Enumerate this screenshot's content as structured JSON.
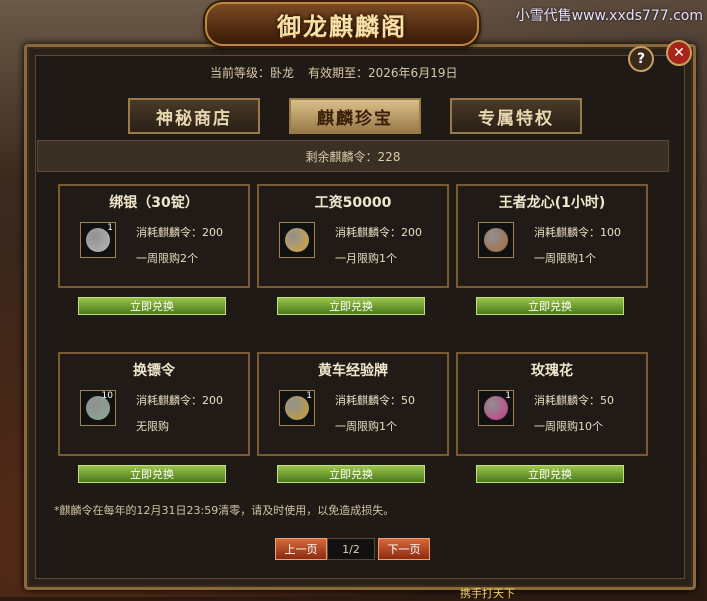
{
  "watermark": "小雪代售www.xxds777.com",
  "title": "御龙麒麟阁",
  "info": {
    "level_label": "当前等级：卧龙",
    "expiry_label": "有效期至：2026年6月19日"
  },
  "tabs": [
    {
      "label": "神秘商店",
      "active": false
    },
    {
      "label": "麒麟珍宝",
      "active": true
    },
    {
      "label": "专属特权",
      "active": false
    }
  ],
  "balance": "剩余麒麟令：228",
  "items": [
    {
      "name": "绑银（30锭）",
      "cost": "消耗麒麟令：200",
      "limit": "一周限购2个",
      "count": "1",
      "icon": "silver-ingot-icon",
      "color": "#b8b8b8",
      "button": "立即兑换"
    },
    {
      "name": "工资50000",
      "cost": "消耗麒麟令：200",
      "limit": "一月限购1个",
      "count": "",
      "icon": "gold-scroll-icon",
      "color": "#d8a838",
      "button": "立即兑换"
    },
    {
      "name": "王者龙心(1小时)",
      "cost": "消耗麒麟令：100",
      "limit": "一周限购1个",
      "count": "",
      "icon": "dragon-heart-icon",
      "color": "#a86a3a",
      "button": "立即兑换"
    },
    {
      "name": "换镖令",
      "cost": "消耗麒麟令：200",
      "limit": "无限购",
      "count": "10",
      "icon": "escort-token-icon",
      "color": "#8aa890",
      "button": "立即兑换"
    },
    {
      "name": "黄车经验牌",
      "cost": "消耗麒麟令：50",
      "limit": "一周限购1个",
      "count": "1",
      "icon": "yellow-cart-icon",
      "color": "#c8a030",
      "button": "立即兑换"
    },
    {
      "name": "玫瑰花",
      "cost": "消耗麒麟令：50",
      "limit": "一周限购10个",
      "count": "1",
      "icon": "rose-icon",
      "color": "#c83a8a",
      "button": "立即兑换"
    }
  ],
  "footnote": "*麒麟令在每年的12月31日23:59清零，请及时使用，以免造成损失。",
  "pager": {
    "prev": "上一页",
    "page": "1/2",
    "next": "下一页"
  },
  "bottom_text": "携手打天下"
}
